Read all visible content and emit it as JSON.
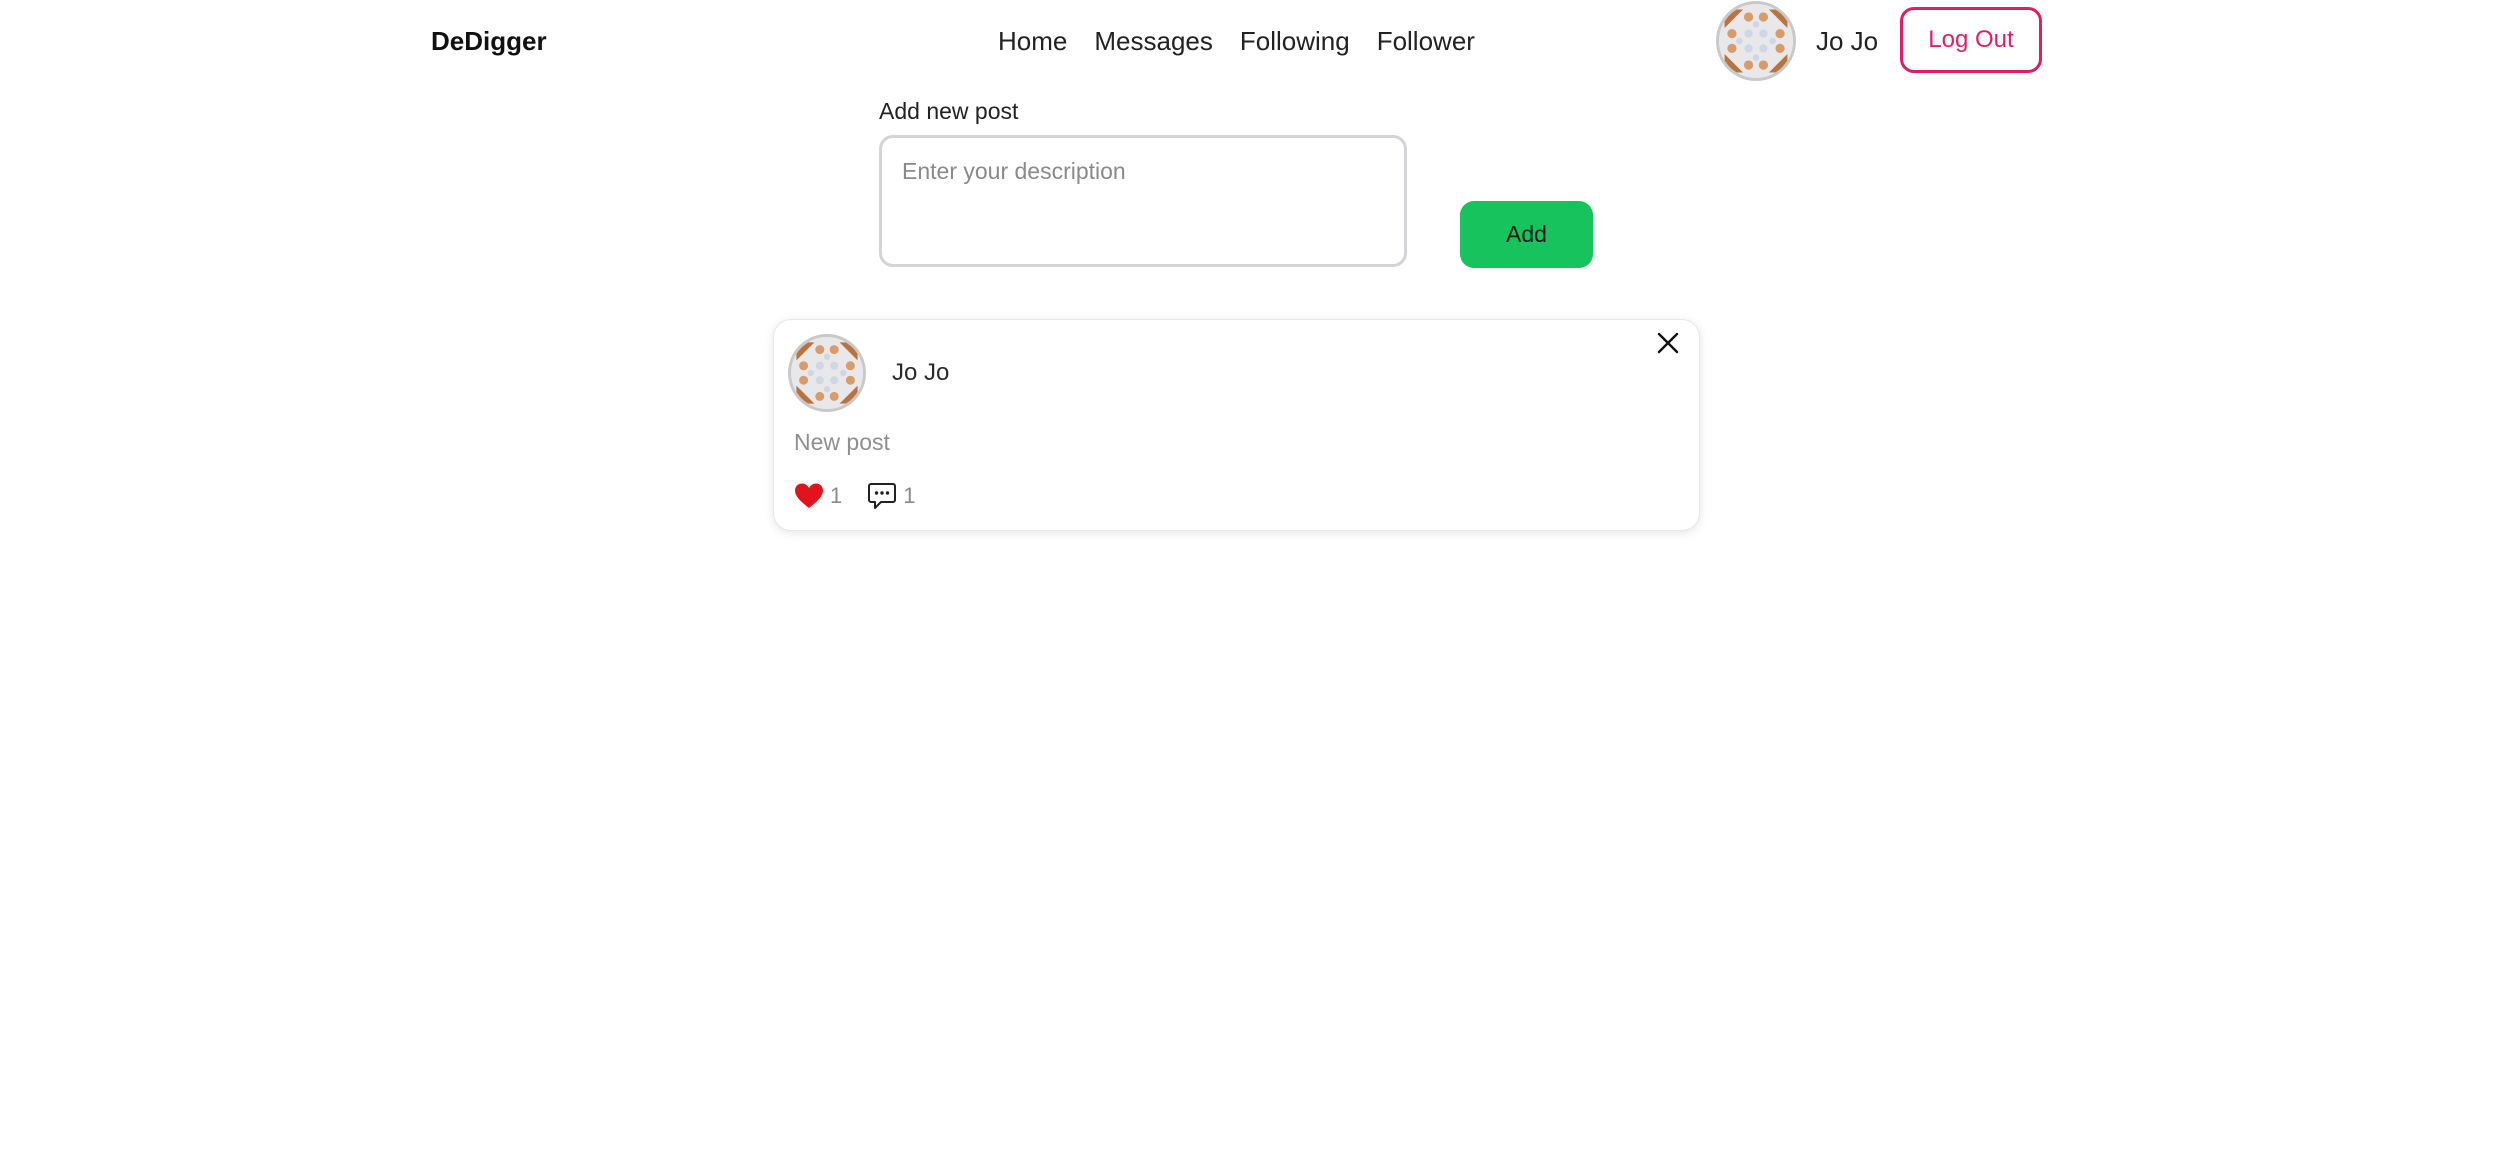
{
  "header": {
    "brand": "DeDigger",
    "nav": [
      {
        "label": "Home"
      },
      {
        "label": "Messages"
      },
      {
        "label": "Following"
      },
      {
        "label": "Follower"
      }
    ],
    "user_name": "Jo Jo",
    "logout_label": "Log Out"
  },
  "composer": {
    "label": "Add new post",
    "placeholder": "Enter your description",
    "value": "",
    "add_label": "Add"
  },
  "posts": [
    {
      "author": "Jo Jo",
      "text": "New post",
      "likes": "1",
      "comments": "1"
    }
  ],
  "colors": {
    "accent_logout": "#e11d63",
    "add_button": "#17c35c",
    "like_heart": "#e1141e"
  },
  "icons": {
    "like": "heart-icon",
    "comment": "comment-icon",
    "close": "close-icon"
  }
}
